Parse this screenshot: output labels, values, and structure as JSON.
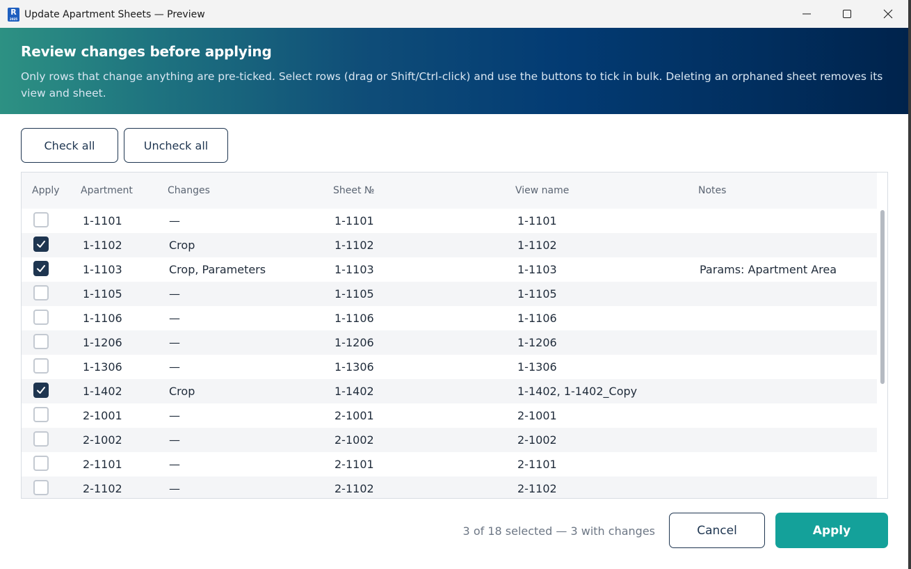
{
  "window": {
    "title": "Update Apartment Sheets — Preview",
    "app_icon_letter": "R",
    "app_icon_sub": "2025"
  },
  "banner": {
    "heading": "Review changes before applying",
    "description": "Only rows that change anything are pre-ticked. Select rows (drag or Shift/Ctrl-click) and use the buttons to tick in bulk. Deleting an orphaned sheet removes its view and sheet."
  },
  "toolbar": {
    "check_all": "Check all",
    "uncheck_all": "Uncheck all"
  },
  "table": {
    "columns": [
      "Apply",
      "Apartment",
      "Changes",
      "Sheet №",
      "View name",
      "Notes"
    ],
    "rows": [
      {
        "checked": false,
        "apartment": "1-1101",
        "changes": "—",
        "sheet": "1-1101",
        "view": "1-1101",
        "notes": ""
      },
      {
        "checked": true,
        "apartment": "1-1102",
        "changes": "Crop",
        "sheet": "1-1102",
        "view": "1-1102",
        "notes": ""
      },
      {
        "checked": true,
        "apartment": "1-1103",
        "changes": "Crop, Parameters",
        "sheet": "1-1103",
        "view": "1-1103",
        "notes": "Params: Apartment Area"
      },
      {
        "checked": false,
        "apartment": "1-1105",
        "changes": "—",
        "sheet": "1-1105",
        "view": "1-1105",
        "notes": ""
      },
      {
        "checked": false,
        "apartment": "1-1106",
        "changes": "—",
        "sheet": "1-1106",
        "view": "1-1106",
        "notes": ""
      },
      {
        "checked": false,
        "apartment": "1-1206",
        "changes": "—",
        "sheet": "1-1206",
        "view": "1-1206",
        "notes": ""
      },
      {
        "checked": false,
        "apartment": "1-1306",
        "changes": "—",
        "sheet": "1-1306",
        "view": "1-1306",
        "notes": ""
      },
      {
        "checked": true,
        "apartment": "1-1402",
        "changes": "Crop",
        "sheet": "1-1402",
        "view": "1-1402, 1-1402_Copy",
        "notes": ""
      },
      {
        "checked": false,
        "apartment": "2-1001",
        "changes": "—",
        "sheet": "2-1001",
        "view": "2-1001",
        "notes": ""
      },
      {
        "checked": false,
        "apartment": "2-1002",
        "changes": "—",
        "sheet": "2-1002",
        "view": "2-1002",
        "notes": ""
      },
      {
        "checked": false,
        "apartment": "2-1101",
        "changes": "—",
        "sheet": "2-1101",
        "view": "2-1101",
        "notes": ""
      },
      {
        "checked": false,
        "apartment": "2-1102",
        "changes": "—",
        "sheet": "2-1102",
        "view": "2-1102",
        "notes": ""
      }
    ]
  },
  "footer": {
    "status": "3 of 18 selected — 3 with changes",
    "cancel_label": "Cancel",
    "apply_label": "Apply"
  },
  "colors": {
    "accent": "#14a19a",
    "navy": "#1e3550",
    "banner_start": "#2d9183",
    "banner_end": "#00234c"
  },
  "icons": {
    "minimize": "minimize-icon",
    "maximize": "maximize-icon",
    "close": "close-icon",
    "checkbox_checked": "checkmark-icon"
  }
}
